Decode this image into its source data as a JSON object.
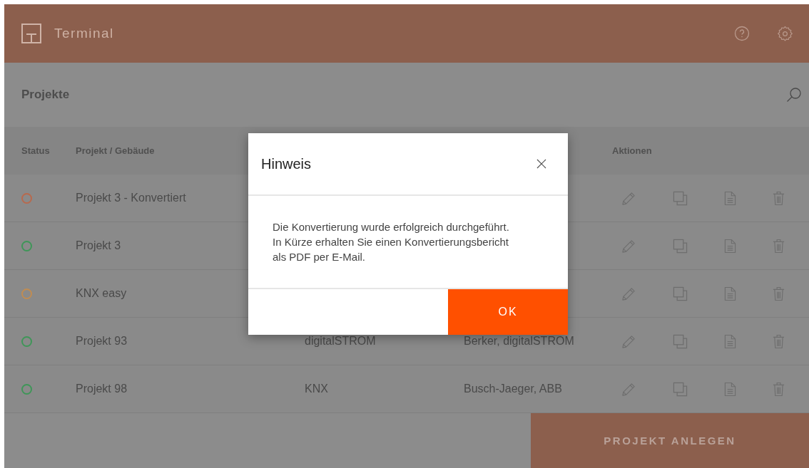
{
  "app": {
    "title": "Terminal"
  },
  "page": {
    "title": "Projekte"
  },
  "table": {
    "columns": [
      "Status",
      "Projekt / Gebäude",
      "Aktionen"
    ],
    "rows": [
      {
        "color": "#b8694d",
        "name": "Projekt 3 - Konvertiert"
      },
      {
        "color": "#3f9658",
        "name": "Projekt 3"
      },
      {
        "color": "#c08c52",
        "name": "KNX easy"
      },
      {
        "color": "#3f9658",
        "name": "Projekt 93",
        "system": "digitalSTROM",
        "manufacturer": "Berker, digitalSTROM"
      },
      {
        "color": "#3f9658",
        "name": "Projekt 98",
        "system": "KNX",
        "manufacturer": "Busch-Jaeger, ABB"
      }
    ]
  },
  "footer": {
    "button": "PROJEKT ANLEGEN"
  },
  "dialog": {
    "title": "Hinweis",
    "message": "Die Konvertierung wurde erfolgreich durchgeführt. In Kürze erhalten Sie einen Konvertierungsbericht als PDF per E-Mail.",
    "button": "OK"
  }
}
